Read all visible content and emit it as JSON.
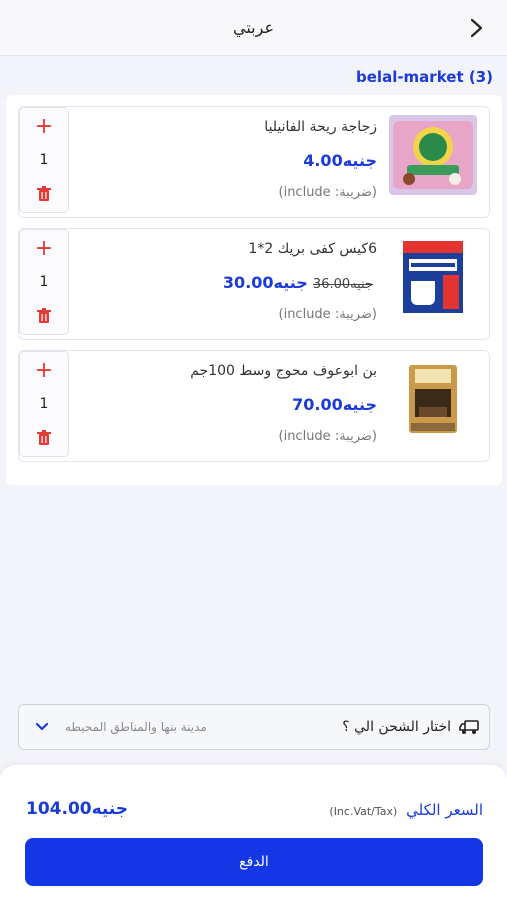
{
  "header": {
    "title": "عربتي"
  },
  "store": {
    "title": "belal-market (3)"
  },
  "items": [
    {
      "name": "زجاجة ريحة الفانيليا",
      "price": "جنيه4.00",
      "old_price": "",
      "tax": "(ضريبة: include)",
      "qty": "1",
      "image_icon": "vanilla-bottle-product"
    },
    {
      "name": "6كيس كفى بريك 2*1",
      "price": "جنيه30.00",
      "old_price": "جنيه36.00",
      "tax": "(ضريبة: include)",
      "qty": "1",
      "image_icon": "coffee-break-product"
    },
    {
      "name": "بن ابوعوف محوج وسط 100جم",
      "price": "جنيه70.00",
      "old_price": "",
      "tax": "(ضريبة: include)",
      "qty": "1",
      "image_icon": "abu-auf-coffee-product"
    }
  ],
  "shipping": {
    "label": "اختار الشحن الي ؟",
    "value": "مدينة بنها والمناطق المحيطه"
  },
  "summary": {
    "total_label": "السعر الكلي",
    "vat_note": "(Inc.Vat/Tax)",
    "total_value": "جنيه104.00"
  },
  "checkout": {
    "pay_label": "الدفع"
  },
  "colors": {
    "accent": "#1a3bd8",
    "danger": "#e53935",
    "button": "#1437e6"
  }
}
